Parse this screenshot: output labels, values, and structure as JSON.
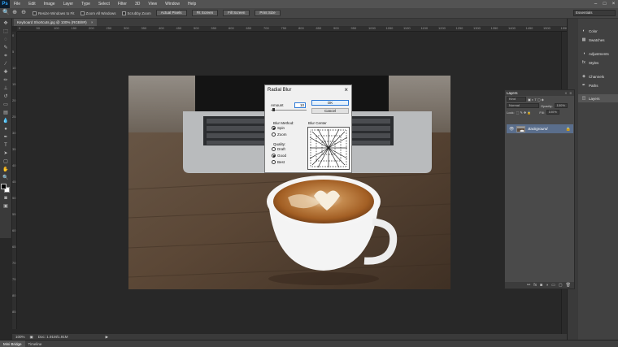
{
  "app": {
    "logo": "Ps",
    "menu": [
      "File",
      "Edit",
      "Image",
      "Layer",
      "Type",
      "Select",
      "Filter",
      "3D",
      "View",
      "Window",
      "Help"
    ],
    "window_controls": [
      "–",
      "□",
      "×"
    ]
  },
  "options_bar": {
    "checkboxes": [
      "Resize Windows to Fit",
      "Zoom All Windows",
      "Scrubby Zoom"
    ],
    "buttons": [
      "Actual Pixels",
      "Fit Screen",
      "Fill Screen",
      "Print Size"
    ],
    "workspace": "Essentials"
  },
  "document": {
    "tab_title": "Keyboard Shortcuts.jpg @ 100% (RGB/8#)",
    "close_glyph": "×",
    "ruler_h": [
      "0",
      "50",
      "100",
      "150",
      "200",
      "250",
      "300",
      "350",
      "400",
      "450",
      "500",
      "550",
      "600",
      "650",
      "700",
      "750",
      "800",
      "850",
      "900",
      "950",
      "1000",
      "1050",
      "1100",
      "1150",
      "1200",
      "1250",
      "1300",
      "1350",
      "1400",
      "1450",
      "1500",
      "1550"
    ],
    "ruler_v": [
      "0",
      "5",
      "10",
      "15",
      "20",
      "25",
      "30",
      "35",
      "40",
      "45",
      "50",
      "55",
      "60",
      "65",
      "70",
      "75",
      "80",
      "85"
    ]
  },
  "status": {
    "zoom": "100%",
    "doc_size": "Doc: 1.91M/1.91M",
    "arrow": "▶"
  },
  "bottom_tabs": [
    "Mini Bridge",
    "Timeline"
  ],
  "dock": [
    {
      "icon": "color-icon",
      "label": "Color"
    },
    {
      "icon": "swatches-icon",
      "label": "Swatches"
    },
    {
      "icon": "adjustments-icon",
      "label": "Adjustments"
    },
    {
      "icon": "styles-icon",
      "label": "Styles"
    },
    {
      "icon": "channels-icon",
      "label": "Channels"
    },
    {
      "icon": "paths-icon",
      "label": "Paths"
    },
    {
      "icon": "layers-icon",
      "label": "Layers"
    }
  ],
  "layers_panel": {
    "title": "Layers",
    "kind_label": "Kind",
    "blend_mode": "Normal",
    "opacity_label": "Opacity:",
    "opacity_value": "100%",
    "lock_label": "Lock:",
    "fill_label": "Fill:",
    "fill_value": "100%",
    "layer_name": "Background"
  },
  "dialog": {
    "title": "Radial Blur",
    "close": "×",
    "amount_label": "Amount",
    "amount_value": "10",
    "ok": "OK",
    "cancel": "Cancel",
    "blur_method_label": "Blur Method:",
    "methods": [
      "Spin",
      "Zoom"
    ],
    "quality_label": "Quality:",
    "qualities": [
      "Draft",
      "Good",
      "Best"
    ],
    "blur_center_label": "Blur Center"
  },
  "colors": {
    "menubar": "#535353",
    "panel": "#3a3a3a",
    "canvas_bg": "#282828",
    "selected_layer": "#5a6e8c",
    "accent": "#2f7bd8"
  }
}
